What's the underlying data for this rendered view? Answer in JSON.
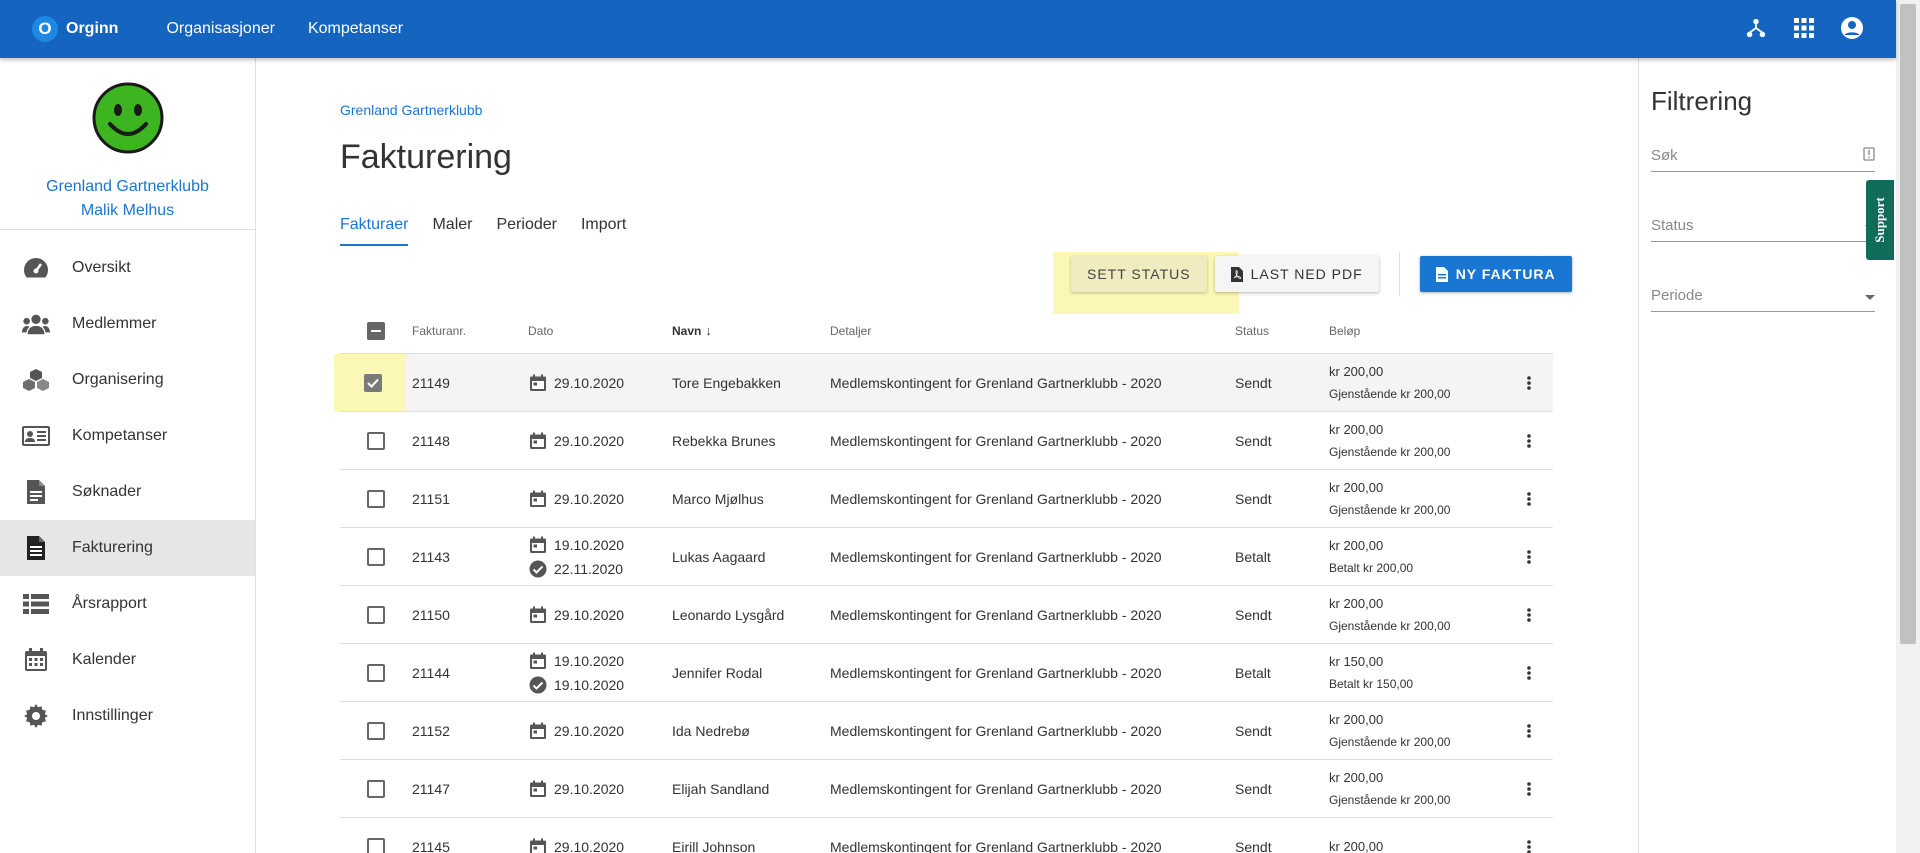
{
  "topbar": {
    "brand_letter": "O",
    "brand_name": "Orginn",
    "nav": [
      "Organisasjoner",
      "Kompetanser"
    ],
    "icons": [
      "hierarchy-icon",
      "apps-grid-icon",
      "account-circle-icon"
    ]
  },
  "sidebar": {
    "org_name": "Grenland Gartnerklubb",
    "user_name": "Malik Melhus",
    "items": [
      {
        "label": "Oversikt",
        "icon": "dashboard-icon"
      },
      {
        "label": "Medlemmer",
        "icon": "people-icon"
      },
      {
        "label": "Organisering",
        "icon": "cubes-icon"
      },
      {
        "label": "Kompetanser",
        "icon": "id-card-icon"
      },
      {
        "label": "Søknader",
        "icon": "document-icon"
      },
      {
        "label": "Fakturering",
        "icon": "invoice-icon"
      },
      {
        "label": "Årsrapport",
        "icon": "list-icon"
      },
      {
        "label": "Kalender",
        "icon": "calendar-icon"
      },
      {
        "label": "Innstillinger",
        "icon": "gear-icon"
      }
    ],
    "active_index": 5
  },
  "main": {
    "breadcrumb": "Grenland Gartnerklubb",
    "title": "Fakturering",
    "tabs": [
      "Fakturaer",
      "Maler",
      "Perioder",
      "Import"
    ],
    "active_tab": 0,
    "buttons": {
      "set_status": "SETT STATUS",
      "download_pdf": "LAST NED PDF",
      "new_invoice": "NY FAKTURA"
    }
  },
  "table": {
    "headers": {
      "number": "Fakturanr.",
      "date": "Dato",
      "name": "Navn",
      "details": "Detaljer",
      "status": "Status",
      "amount": "Beløp"
    },
    "rows": [
      {
        "number": "21149",
        "date": "29.10.2020",
        "paid_date": "",
        "name": "Tore Engebakken",
        "details": "Medlemskontingent for Grenland Gartnerklubb - 2020",
        "status": "Sendt",
        "amount": "kr 200,00",
        "amount_sub": "Gjenstående kr 200,00",
        "selected": true
      },
      {
        "number": "21148",
        "date": "29.10.2020",
        "paid_date": "",
        "name": "Rebekka Brunes",
        "details": "Medlemskontingent for Grenland Gartnerklubb - 2020",
        "status": "Sendt",
        "amount": "kr 200,00",
        "amount_sub": "Gjenstående kr 200,00",
        "selected": false
      },
      {
        "number": "21151",
        "date": "29.10.2020",
        "paid_date": "",
        "name": "Marco Mjølhus",
        "details": "Medlemskontingent for Grenland Gartnerklubb - 2020",
        "status": "Sendt",
        "amount": "kr 200,00",
        "amount_sub": "Gjenstående kr 200,00",
        "selected": false
      },
      {
        "number": "21143",
        "date": "19.10.2020",
        "paid_date": "22.11.2020",
        "name": "Lukas Aagaard",
        "details": "Medlemskontingent for Grenland Gartnerklubb - 2020",
        "status": "Betalt",
        "amount": "kr 200,00",
        "amount_sub": "Betalt kr 200,00",
        "selected": false
      },
      {
        "number": "21150",
        "date": "29.10.2020",
        "paid_date": "",
        "name": "Leonardo Lysgård",
        "details": "Medlemskontingent for Grenland Gartnerklubb - 2020",
        "status": "Sendt",
        "amount": "kr 200,00",
        "amount_sub": "Gjenstående kr 200,00",
        "selected": false
      },
      {
        "number": "21144",
        "date": "19.10.2020",
        "paid_date": "19.10.2020",
        "name": "Jennifer Rodal",
        "details": "Medlemskontingent for Grenland Gartnerklubb - 2020",
        "status": "Betalt",
        "amount": "kr 150,00",
        "amount_sub": "Betalt kr 150,00",
        "selected": false
      },
      {
        "number": "21152",
        "date": "29.10.2020",
        "paid_date": "",
        "name": "Ida Nedrebø",
        "details": "Medlemskontingent for Grenland Gartnerklubb - 2020",
        "status": "Sendt",
        "amount": "kr 200,00",
        "amount_sub": "Gjenstående kr 200,00",
        "selected": false
      },
      {
        "number": "21147",
        "date": "29.10.2020",
        "paid_date": "",
        "name": "Elijah Sandland",
        "details": "Medlemskontingent for Grenland Gartnerklubb - 2020",
        "status": "Sendt",
        "amount": "kr 200,00",
        "amount_sub": "Gjenstående kr 200,00",
        "selected": false
      },
      {
        "number": "21145",
        "date": "29.10.2020",
        "paid_date": "",
        "name": "Eirill Johnson",
        "details": "Medlemskontingent for Grenland Gartnerklubb - 2020",
        "status": "Sendt",
        "amount": "kr 200,00",
        "amount_sub": "",
        "selected": false
      }
    ]
  },
  "filter": {
    "title": "Filtrering",
    "search_placeholder": "Søk",
    "status_label": "Status",
    "period_label": "Periode",
    "support_label": "Support"
  },
  "colors": {
    "primary": "#1565c0",
    "accent": "#1976d2",
    "highlight": "#fbf8b5",
    "support": "#106b5b"
  }
}
